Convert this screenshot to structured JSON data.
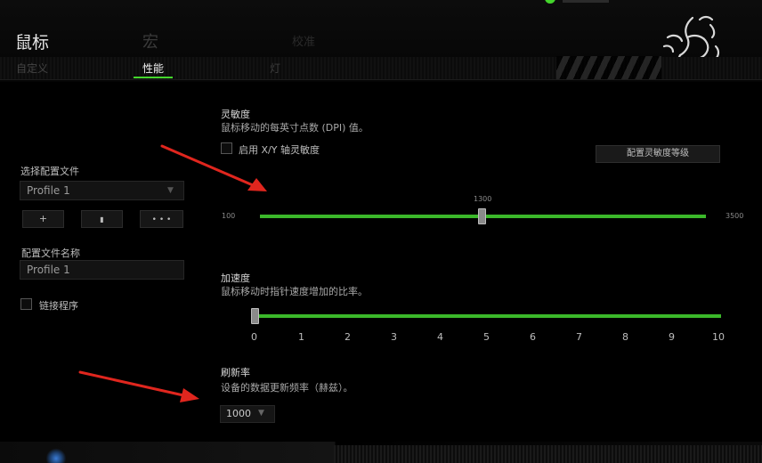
{
  "header": {
    "title": "鼠标",
    "macro_tab": "宏",
    "faint_tab": "校准",
    "tabs": [
      {
        "label": "自定义"
      },
      {
        "label": "性能"
      },
      {
        "label": "灯"
      }
    ],
    "active_tab": "性能",
    "accent_color": "#44d62c"
  },
  "left_panel": {
    "select_profile_label": "选择配置文件",
    "profile_value": "Profile 1",
    "buttons": [
      {
        "label": "+",
        "icon": "add-icon"
      },
      {
        "label": "▮",
        "icon": "delete-icon"
      },
      {
        "label": "• • •",
        "icon": "more-icon"
      }
    ],
    "profile_name_label": "配置文件名称",
    "profile_name_value": "Profile 1",
    "link_program_label": "链接程序"
  },
  "sensitivity": {
    "title": "灵敏度",
    "description": "鼠标移动的每英寸点数 (DPI) 值。",
    "xy_checkbox_label": "启用 X/Y 轴灵敏度",
    "config_button": "配置灵敏度等级",
    "min": "100",
    "max": "3500",
    "current": "1300",
    "value": 1300
  },
  "acceleration": {
    "title": "加速度",
    "description": "鼠标移动时指针速度增加的比率。",
    "ticks": [
      "0",
      "1",
      "2",
      "3",
      "4",
      "5",
      "6",
      "7",
      "8",
      "9",
      "10"
    ],
    "value": 0
  },
  "polling_rate": {
    "title": "刷新率",
    "description": "设备的数据更新频率（赫兹）。",
    "value": "1000"
  }
}
